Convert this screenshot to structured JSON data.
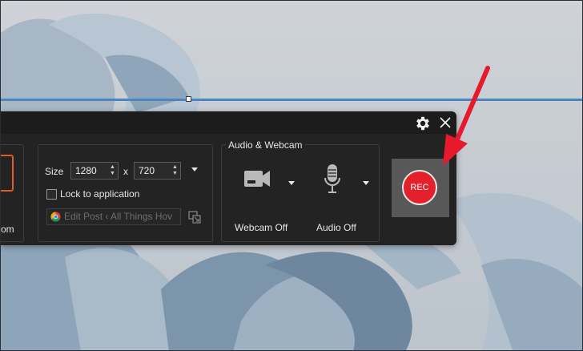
{
  "toolbar": {
    "mode_label_partial": "om",
    "size": {
      "label": "Size",
      "width": "1280",
      "x_label": "x",
      "height": "720",
      "lock_label": "Lock to application",
      "lock_checked": false,
      "app_value": "Edit Post ‹ All Things Hov"
    },
    "audio_webcam": {
      "title": "Audio & Webcam",
      "webcam_label": "Webcam Off",
      "audio_label": "Audio Off"
    },
    "rec_label": "REC"
  },
  "colors": {
    "rec_red": "#e4202a",
    "toolbar_bg": "#1c1c1c",
    "capture_line": "#4a86c0",
    "arrow_red": "#e8192c",
    "mode_accent": "#e05a2b"
  },
  "icons": [
    "gear-icon",
    "close-icon",
    "chrome-icon",
    "pick-window-icon",
    "webcam-icon",
    "microphone-icon",
    "chevron-down-icon"
  ]
}
